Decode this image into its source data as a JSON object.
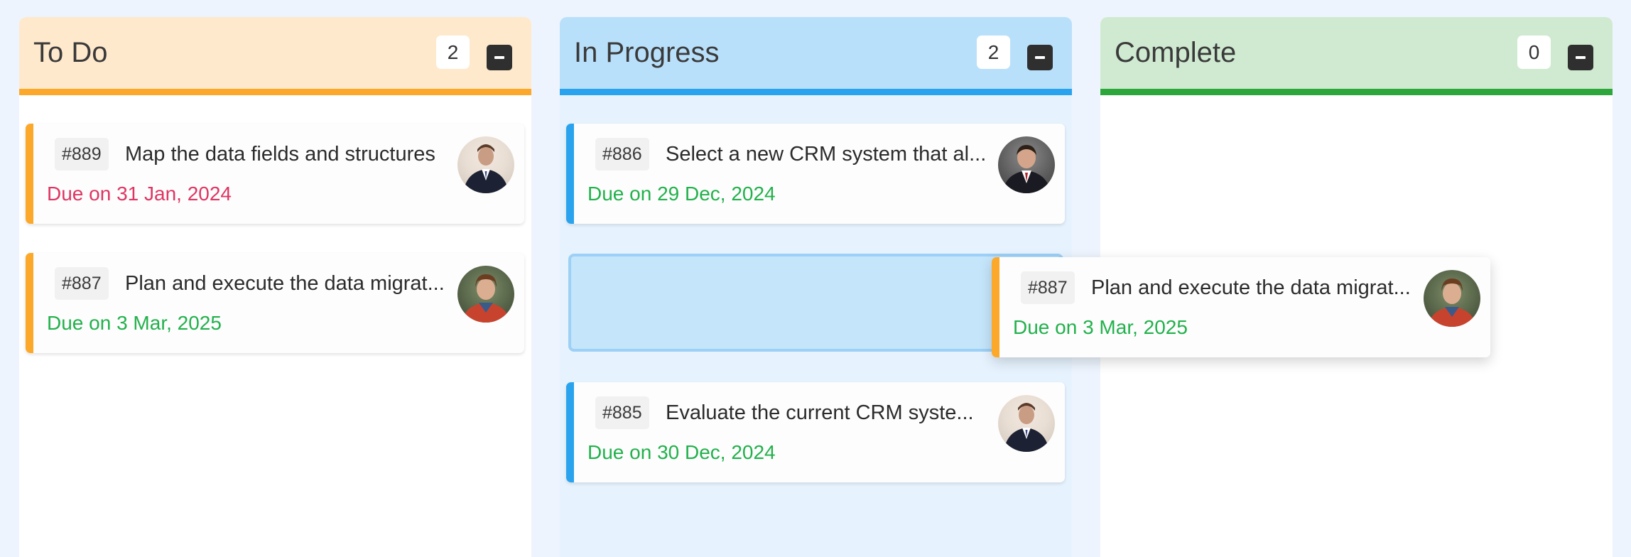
{
  "columns": [
    {
      "title": "To Do",
      "count": "2",
      "cards": [
        {
          "id": "#889",
          "title": "Map the data fields and structures",
          "due": "Due on 31 Jan, 2024"
        },
        {
          "id": "#887",
          "title": "Plan and execute the data migrat...",
          "due": "Due on 3 Mar, 2025"
        }
      ]
    },
    {
      "title": "In Progress",
      "count": "2",
      "cards": [
        {
          "id": "#886",
          "title": "Select a new CRM system that al...",
          "due": "Due on 29 Dec, 2024"
        },
        {
          "id": "#885",
          "title": "Evaluate the current CRM syste...",
          "due": "Due on 30 Dec, 2024"
        }
      ]
    },
    {
      "title": "Complete",
      "count": "0",
      "cards": []
    }
  ],
  "dragging_card": {
    "id": "#887",
    "title": "Plan and execute the data migrat...",
    "due": "Due on 3 Mar, 2025"
  },
  "colors": {
    "todo_accent": "#fca92b",
    "progress_accent": "#2aa3ee",
    "complete_accent": "#2da63c",
    "due_ok": "#22b14c",
    "due_overdue": "#df3562"
  }
}
